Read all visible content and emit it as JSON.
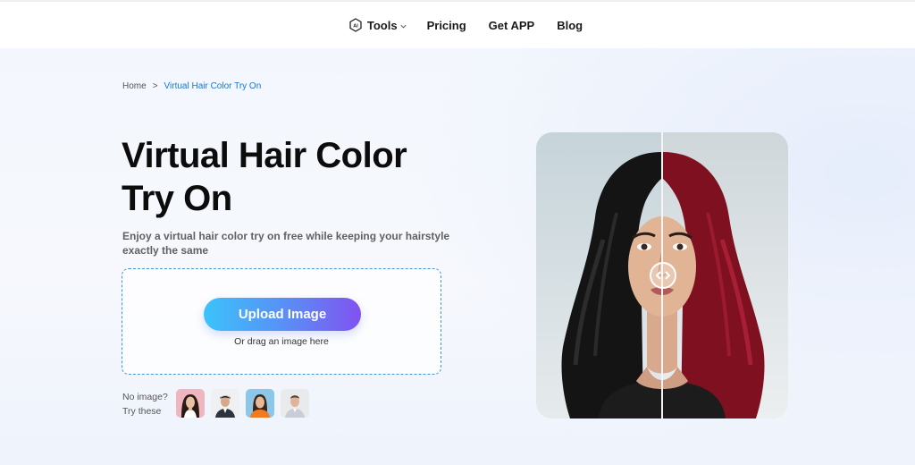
{
  "nav": {
    "tools_label": "Tools",
    "pricing_label": "Pricing",
    "app_label": "Get APP",
    "blog_label": "Blog",
    "tools_icon": "ai-icon",
    "tools_chevron": "chevron-down-icon"
  },
  "breadcrumb": {
    "home": "Home",
    "separator": ">",
    "current": "Virtual Hair Color Try On"
  },
  "hero": {
    "title_line1": "Virtual Hair Color",
    "title_line2": "Try On",
    "subtitle": "Enjoy a virtual hair color try on free while keeping your hairstyle exactly the same"
  },
  "upload": {
    "button_label": "Upload Image",
    "drag_hint": "Or drag an image here"
  },
  "samples": {
    "label_line1": "No image?",
    "label_line2": "Try these"
  },
  "preview": {
    "handle_icon": "compare-arrows-icon"
  },
  "colors": {
    "accent": "#1677d9",
    "button_gradient_start": "#3cc3fb",
    "button_gradient_end": "#8152f0",
    "dashed_border": "#3b96e6",
    "hair_red": "#8e1426"
  }
}
